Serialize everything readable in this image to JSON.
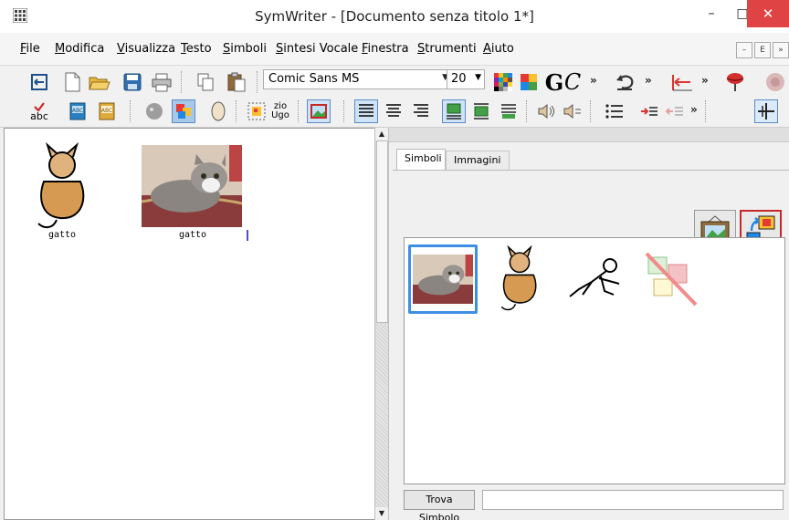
{
  "window": {
    "title": "SymWriter - [Documento senza titolo 1*]",
    "min_glyph": "–",
    "max_glyph": "□",
    "close_glyph": "✕"
  },
  "menu": {
    "items": [
      "File",
      "Modifica",
      "Visualizza",
      "Testo",
      "Simboli",
      "Sintesi Vocale",
      "Finestra",
      "Strumenti",
      "Aiuto"
    ],
    "mdi_buttons": [
      "–",
      "Ε",
      "»"
    ]
  },
  "toolbar": {
    "font_name": "Comic Sans MS",
    "font_size": "20",
    "bold_glyph": "G",
    "italic_glyph": "C",
    "more_glyph": "»",
    "spell_label": "abc",
    "zio_label_top": "zio",
    "zio_label_bottom": "Ugo"
  },
  "document": {
    "words": [
      {
        "label": "gatto"
      },
      {
        "label": "gatto"
      }
    ]
  },
  "panel": {
    "tabs": [
      "Simboli",
      "Immagini"
    ],
    "find_button": "Trova Simbolo",
    "find_value": ""
  },
  "colors": {
    "accent": "#3d8fe6",
    "close": "#e04343",
    "cat_body": "#d69a52",
    "cat_head": "#e0b27e"
  }
}
